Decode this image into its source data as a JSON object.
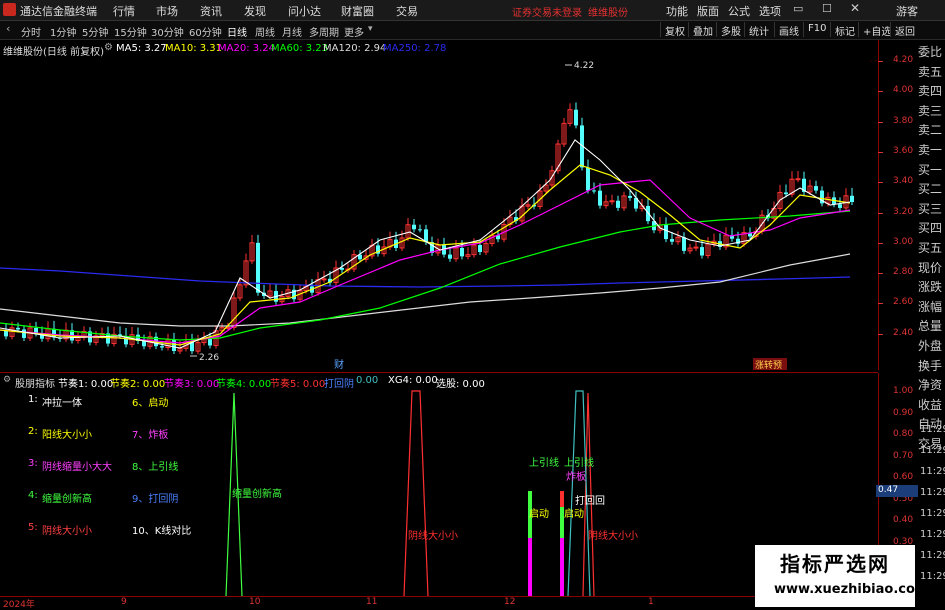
{
  "topbar": {
    "app_title": "通达信金融终端",
    "menus": [
      "行情",
      "市场",
      "资讯",
      "发现",
      "问小达",
      "财富圈",
      "交易"
    ],
    "login_warning": "证券交易未登录",
    "stock_name": "维维股份",
    "right_menus": [
      "功能",
      "版面",
      "公式",
      "选项"
    ],
    "user": "游客"
  },
  "toolbar": {
    "periods": [
      "分时",
      "1分钟",
      "5分钟",
      "15分钟",
      "30分钟",
      "60分钟",
      "日线",
      "周线",
      "月线",
      "多周期",
      "更多"
    ],
    "active_period": "日线",
    "buttons": [
      "复权",
      "叠加",
      "多股",
      "统计",
      "画线",
      "F10",
      "标记",
      "+自选",
      "返回"
    ]
  },
  "main_chart": {
    "title": "维维股份(日线 前复权)",
    "ma_legend": [
      {
        "label": "MA5: 3.27",
        "color": "#ffffff"
      },
      {
        "label": "MA10: 3.31",
        "color": "#ffff00"
      },
      {
        "label": "MA20: 3.24",
        "color": "#ff00ff"
      },
      {
        "label": "MA60: 3.23",
        "color": "#00ff00"
      },
      {
        "label": "MA120: 2.94",
        "color": "#dcdcdc"
      },
      {
        "label": "MA250: 2.78",
        "color": "#2a2af0"
      }
    ],
    "price_ticks": [
      "4.20",
      "4.00",
      "3.80",
      "3.60",
      "3.40",
      "3.20",
      "3.00",
      "2.80",
      "2.60",
      "2.40"
    ],
    "high_label": "4.22",
    "low_label": "2.26",
    "marker_cai": "财",
    "marker_zhang": "涨转预"
  },
  "order_book": [
    "委比",
    "卖五",
    "卖四",
    "卖三",
    "卖二",
    "卖一",
    "买一",
    "买二",
    "买三",
    "买四",
    "买五",
    "现价",
    "涨跌",
    "涨幅",
    "总量",
    "外盘",
    "换手",
    "净资",
    "收益",
    "自动",
    "交易"
  ],
  "indicator": {
    "name": "股朋指标",
    "values": [
      {
        "label": "节奏1: 0.00",
        "color": "#ffffff"
      },
      {
        "label": "节奏2: 0.00",
        "color": "#ffff00"
      },
      {
        "label": "节奏3: 0.00",
        "color": "#ff00ff"
      },
      {
        "label": "节奏4: 0.00",
        "color": "#00ff00"
      },
      {
        "label": "节奏5: 0.00",
        "color": "#ff3030"
      },
      {
        "label": "打回阴",
        "color": "#4a80ff"
      },
      {
        "label": "0.00",
        "color": "#40c0c0"
      },
      {
        "label": "XG4: 0.00",
        "color": "#ffffff"
      },
      {
        "label": "选股: 0.00",
        "color": "#ffffff"
      }
    ],
    "legend_left": [
      {
        "num": "1:",
        "text": "冲拉一体",
        "color": "#ffffff"
      },
      {
        "num": "2:",
        "text": "阳线大小小",
        "color": "#ffff00"
      },
      {
        "num": "3:",
        "text": "阴线缩量小大大",
        "color": "#ff40ff"
      },
      {
        "num": "4:",
        "text": "缩量创新高",
        "color": "#40ff40"
      },
      {
        "num": "5:",
        "text": "阴线大小小",
        "color": "#ff4040"
      }
    ],
    "legend_right": [
      {
        "text": "6、启动",
        "color": "#ffff00"
      },
      {
        "text": "7、炸板",
        "color": "#ff40ff"
      },
      {
        "text": "8、上引线",
        "color": "#40ff40"
      },
      {
        "text": "9、打回阴",
        "color": "#4a80ff"
      },
      {
        "text": "10、K线对比",
        "color": "#ffffff"
      }
    ],
    "ticks": [
      "1.00",
      "0.90",
      "0.80",
      "0.70",
      "0.60",
      "0.50",
      "0.40",
      "0.30",
      "0.20",
      "0.10"
    ],
    "badge": "0.47",
    "chart_labels": {
      "suo_liang": "缩量创新高",
      "yin_xian_1": "阴线大小小",
      "shang_yin_1": "上引线",
      "shang_yin_2": "上引线",
      "qi_dong_1": "启动",
      "qi_dong_2": "启动",
      "zha_ban": "炸板",
      "da_hui": "打回回",
      "yin_xian_2": "阴线大小小"
    }
  },
  "time_labels": [
    "11:29",
    "11:29",
    "11:29",
    "11:29",
    "11:29",
    "11:29",
    "11:29",
    "11:29"
  ],
  "dates": [
    "2024年",
    "9",
    "10",
    "11",
    "12",
    "1"
  ],
  "watermark": {
    "cn": "指标严选网",
    "url": "www.xuezhibiao.com"
  }
}
